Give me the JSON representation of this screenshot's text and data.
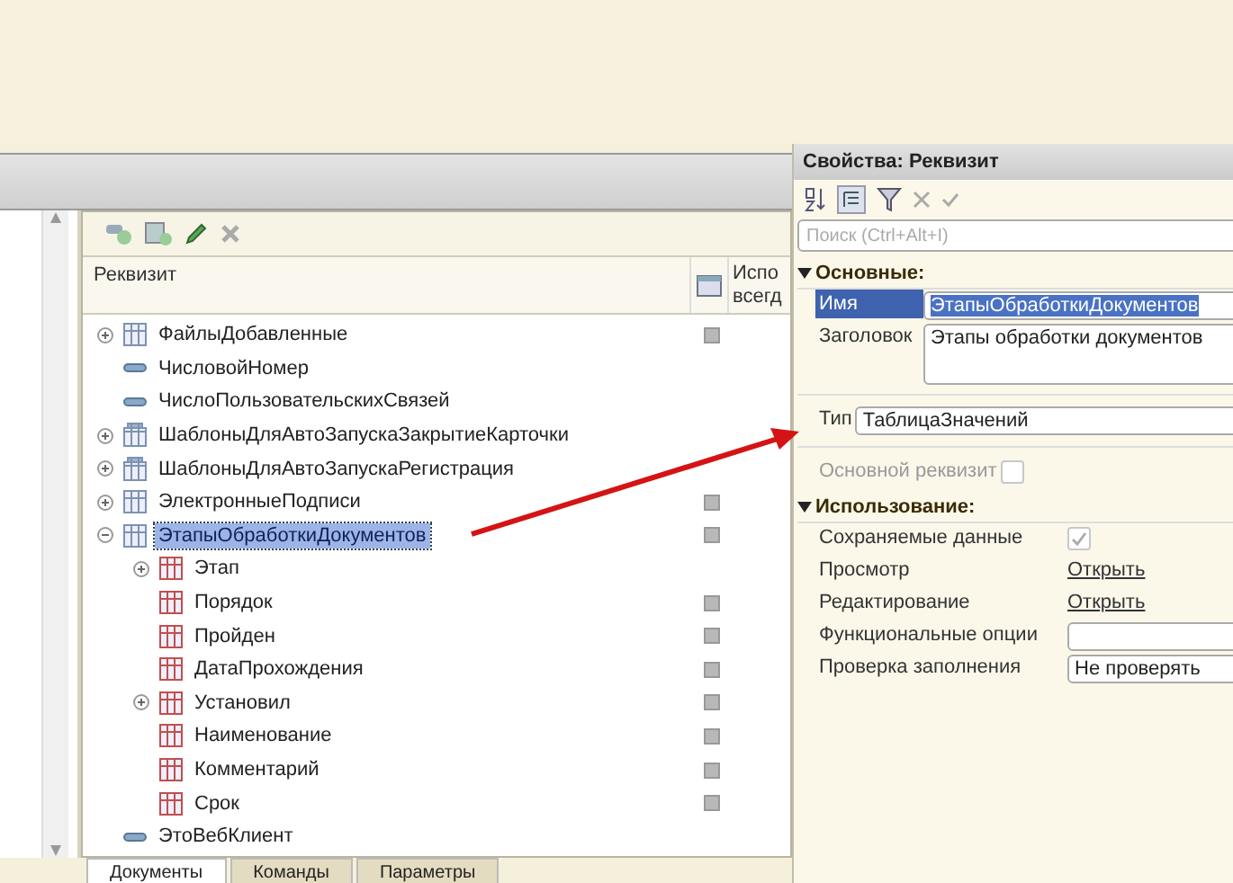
{
  "tree": {
    "columns": [
      {
        "label": "Реквизит"
      },
      {
        "lines": [
          "Испо",
          "всегд"
        ]
      }
    ],
    "items": [
      {
        "label": "ФайлыДобавленные",
        "kind": "table",
        "expanded": false,
        "flag": true,
        "selected": false
      },
      {
        "label": "ЧисловойНомер",
        "kind": "attribute",
        "flag": false,
        "selected": false
      },
      {
        "label": "ЧислоПользовательскихСвязей",
        "kind": "attribute",
        "flag": false,
        "selected": false
      },
      {
        "label": "ШаблоныДляАвтоЗапускаЗакрытиеКарточки",
        "kind": "register",
        "expanded": false,
        "flag": false,
        "selected": false
      },
      {
        "label": "ШаблоныДляАвтоЗапускаРегистрация",
        "kind": "register",
        "expanded": false,
        "flag": false,
        "selected": false
      },
      {
        "label": "ЭлектронныеПодписи",
        "kind": "table",
        "expanded": false,
        "flag": true,
        "selected": false
      },
      {
        "label": "ЭтапыОбработкиДокументов",
        "kind": "table",
        "expanded": true,
        "flag": true,
        "selected": true,
        "children": [
          {
            "label": "Этап",
            "kind": "column",
            "expanded": false,
            "flag": false,
            "selected": false
          },
          {
            "label": "Порядок",
            "kind": "column",
            "flag": true,
            "selected": false
          },
          {
            "label": "Пройден",
            "kind": "column",
            "flag": true,
            "selected": false
          },
          {
            "label": "ДатаПрохождения",
            "kind": "column",
            "flag": true,
            "selected": false
          },
          {
            "label": "Установил",
            "kind": "column",
            "expanded": false,
            "flag": true,
            "selected": false
          },
          {
            "label": "Наименование",
            "kind": "column",
            "flag": true,
            "selected": false
          },
          {
            "label": "Комментарий",
            "kind": "column",
            "flag": true,
            "selected": false
          },
          {
            "label": "Срок",
            "kind": "column",
            "flag": true,
            "selected": false
          }
        ]
      },
      {
        "label": "ЭтоВебКлиент",
        "kind": "attribute",
        "flag": false,
        "selected": false
      }
    ]
  },
  "bottom_tabs": [
    {
      "label": "Документы",
      "selected": true
    },
    {
      "label": "Команды",
      "selected": false
    },
    {
      "label": "Параметры",
      "selected": false
    }
  ],
  "properties": {
    "title": "Свойства: Реквизит",
    "search": {
      "placeholder": "Поиск (Ctrl+Alt+I)"
    },
    "sections": [
      {
        "title": "Основные:",
        "expanded": true,
        "rows": [
          {
            "kind": "field",
            "label": "Имя",
            "value": "ЭтапыОбработкиДокументов",
            "selected": true
          },
          {
            "kind": "textarea",
            "label": "Заголовок",
            "value": "Этапы обработки документов",
            "selected": false
          },
          {
            "kind": "separator"
          },
          {
            "kind": "field",
            "label": "Тип",
            "value": "ТаблицаЗначений",
            "selected": false
          },
          {
            "kind": "separator"
          },
          {
            "kind": "checkbox",
            "label": "Основной реквизит",
            "checked": false,
            "disabled": true
          }
        ]
      },
      {
        "title": "Использование:",
        "expanded": true,
        "rows": [
          {
            "kind": "checkbox",
            "label": "Сохраняемые данные",
            "checked": true,
            "disabled": true
          },
          {
            "kind": "link",
            "label": "Просмотр",
            "value": "Открыть"
          },
          {
            "kind": "link",
            "label": "Редактирование",
            "value": "Открыть"
          },
          {
            "kind": "field",
            "label": "Функциональные опции",
            "selected": false
          },
          {
            "kind": "field",
            "label": "Проверка заполнения",
            "value": "Не проверять",
            "selected": false
          }
        ]
      }
    ]
  }
}
